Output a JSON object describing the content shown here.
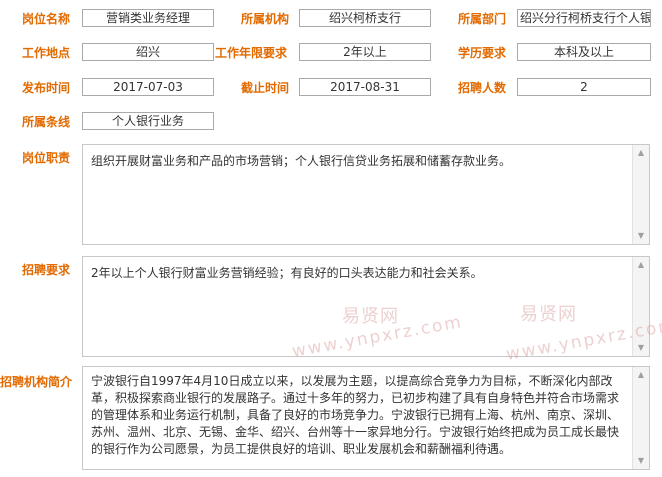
{
  "fields": {
    "position_name": {
      "label": "岗位名称",
      "value": "营销类业务经理"
    },
    "department_org": {
      "label": "所属机构",
      "value": "绍兴柯桥支行"
    },
    "department": {
      "label": "所属部门",
      "value": "绍兴分行柯桥支行个人银"
    },
    "work_location": {
      "label": "工作地点",
      "value": "绍兴"
    },
    "work_years": {
      "label": "工作年限要求",
      "value": "2年以上"
    },
    "education": {
      "label": "学历要求",
      "value": "本科及以上"
    },
    "publish_time": {
      "label": "发布时间",
      "value": "2017-07-03"
    },
    "deadline": {
      "label": "截止时间",
      "value": "2017-08-31"
    },
    "headcount": {
      "label": "招聘人数",
      "value": "2"
    },
    "business_line": {
      "label": "所属条线",
      "value": "个人银行业务"
    }
  },
  "sections": {
    "duties": {
      "label": "岗位职责",
      "text": "组织开展财富业务和产品的市场营销；个人银行信贷业务拓展和储蓄存款业务。"
    },
    "requirements": {
      "label": "招聘要求",
      "text": "2年以上个人银行财富业务营销经验；有良好的口头表达能力和社会关系。"
    },
    "org_intro": {
      "label": "招聘机构简介",
      "text": "宁波银行自1997年4月10日成立以来，以发展为主题，以提高综合竞争力为目标，不断深化内部改革，积极探索商业银行的发展路子。通过十多年的努力，已初步构建了具有自身特色并符合市场需求的管理体系和业务运行机制，具备了良好的市场竞争力。宁波银行已拥有上海、杭州、南京、深圳、苏州、温州、北京、无锡、金华、绍兴、台州等十一家异地分行。宁波银行始终把成为员工成长最快的银行作为公司愿景，为员工提供良好的培训、职业发展机会和薪酬福利待遇。"
    }
  },
  "watermark": {
    "brand": "易贤网",
    "url": "www.ynpxrz.com"
  }
}
